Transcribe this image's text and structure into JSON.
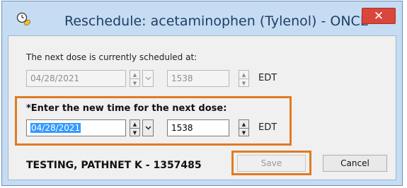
{
  "window": {
    "title": "Reschedule: acetaminophen (Tylenol) -  ONCE",
    "close_glyph": "✕",
    "icon": "clock-pill-icon"
  },
  "current": {
    "label": "The next dose is currently scheduled at:",
    "date": "04/28/2021",
    "time": "1538",
    "timezone": "EDT"
  },
  "new_time": {
    "label": "*Enter the new time for the next dose:",
    "date": "04/28/2021",
    "time": "1538",
    "timezone": "EDT"
  },
  "patient": {
    "text": "TESTING, PATHNET K - 1357485"
  },
  "buttons": {
    "save": "Save",
    "cancel": "Cancel"
  },
  "colors": {
    "highlight": "#e07b23",
    "titlebar": "#c6dcf2",
    "close": "#d9463b",
    "selection": "#3399ff"
  }
}
